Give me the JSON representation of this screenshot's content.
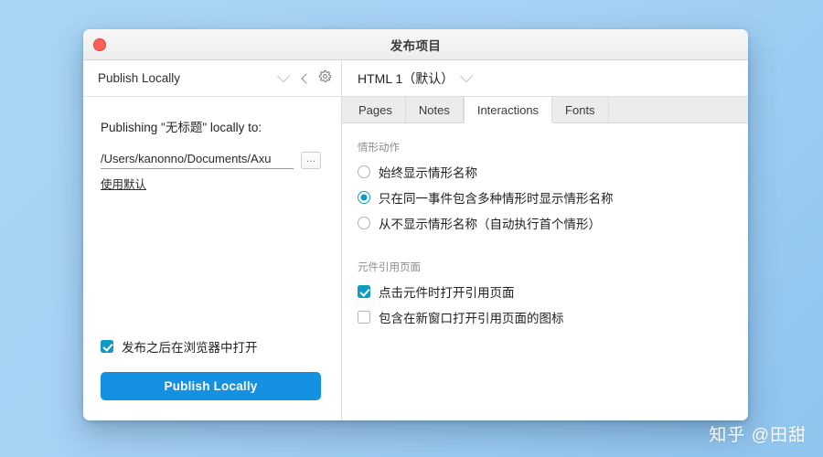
{
  "window": {
    "title": "发布项目",
    "traffic_light_close": "close-button"
  },
  "left_panel": {
    "preset_label": "Publish Locally",
    "collapse_icon": "chevron-left-icon",
    "settings_icon": "gear-icon",
    "publishing_label": "Publishing \"无标题\" locally to:",
    "path_value": "/Users/kanonno/Documents/Axu",
    "browse_button_label": "…",
    "use_default_link": "使用默认",
    "open_in_browser_label": "发布之后在浏览器中打开",
    "open_in_browser_checked": true,
    "publish_button_label": "Publish Locally"
  },
  "right_panel": {
    "config_name": "HTML 1（默认）",
    "config_dropdown_icon": "chevron-down-icon",
    "tabs": [
      {
        "label": "Pages",
        "active": false
      },
      {
        "label": "Notes",
        "active": false
      },
      {
        "label": "Interactions",
        "active": true
      },
      {
        "label": "Fonts",
        "active": false
      }
    ],
    "groups": [
      {
        "title": "情形动作",
        "type": "radio",
        "options": [
          {
            "label": "始终显示情形名称",
            "selected": false
          },
          {
            "label": "只在同一事件包含多种情形时显示情形名称",
            "selected": true
          },
          {
            "label": "从不显示情形名称（自动执行首个情形）",
            "selected": false
          }
        ]
      },
      {
        "title": "元件引用页面",
        "type": "checkbox",
        "options": [
          {
            "label": "点击元件时打开引用页面",
            "checked": true
          },
          {
            "label": "包含在新窗口打开引用页面的图标",
            "checked": false
          }
        ]
      }
    ]
  },
  "watermark": {
    "text": "知乎 @田甜"
  },
  "colors": {
    "accent_blue": "#1491e0",
    "control_teal": "#0f9bc4",
    "close_red": "#ff5f57",
    "desktop_blue": "#a9d6f6"
  }
}
